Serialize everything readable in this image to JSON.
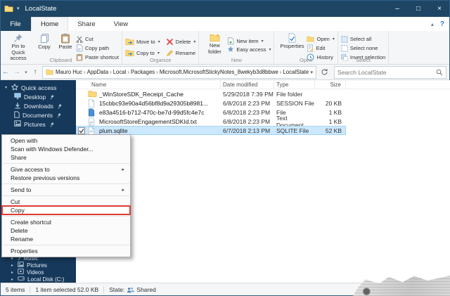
{
  "glyphs": {
    "min": "–",
    "max": "□",
    "close": "×",
    "dropdown": "▾",
    "submenu": "▸",
    "collapse": "▾",
    "expand": "▸",
    "crumb_sep": "›",
    "back": "←",
    "forward": "→",
    "up": "↑",
    "ribbon_toggle": "▴",
    "help": "?"
  },
  "window": {
    "title": "LocalState"
  },
  "ribbon": {
    "file_tab": "File",
    "tabs": [
      "Home",
      "Share",
      "View"
    ],
    "clipboard": {
      "pin": "Pin to Quick access",
      "copy": "Copy",
      "paste": "Paste",
      "cut": "Cut",
      "copy_path": "Copy path",
      "paste_shortcut": "Paste shortcut",
      "label": "Clipboard"
    },
    "organize": {
      "move_to": "Move to",
      "copy_to": "Copy to",
      "delete": "Delete",
      "rename": "Rename",
      "label": "Organize"
    },
    "new": {
      "new_folder": "New folder",
      "new_item": "New item",
      "easy_access": "Easy access",
      "label": "New"
    },
    "open": {
      "properties": "Properties",
      "open": "Open",
      "edit": "Edit",
      "history": "History",
      "label": "Open"
    },
    "select": {
      "select_all": "Select all",
      "select_none": "Select none",
      "invert": "Invert selection",
      "label": "Select"
    }
  },
  "addressbar": {
    "crumbs": [
      "Mauro Huc",
      "AppData",
      "Local",
      "Packages",
      "Microsoft.MicrosoftStickyNotes_8wekyb3d8bbwe",
      "LocalState"
    ],
    "search_placeholder": "Search LocalState"
  },
  "sidebar": {
    "quick_access": "Quick access",
    "pinned": [
      "Desktop",
      "Downloads",
      "Documents",
      "Pictures"
    ],
    "lower": [
      "Music",
      "Pictures",
      "Videos",
      "Local Disk (C:)"
    ]
  },
  "files": {
    "columns": [
      "Name",
      "Date modified",
      "Type",
      "Size"
    ],
    "rows": [
      {
        "name": "_WinStoreSDK_Receipt_Cache",
        "modified": "5/29/2018 7:39 PM",
        "type": "File folder",
        "size": ""
      },
      {
        "name": "15cbbc93e90a4d56bf8d9a29305b8981...",
        "modified": "6/8/2018 2:23 PM",
        "type": "SESSION File",
        "size": "20 KB"
      },
      {
        "name": "e83a4516-b712-470c-be7d-99d5fc4e7c",
        "modified": "6/8/2018 2:23 PM",
        "type": "File",
        "size": "1 KB"
      },
      {
        "name": "MicrosoftStoreEngagementSDKId.txt",
        "modified": "6/8/2018 2:23 PM",
        "type": "Text Document",
        "size": "1 KB"
      },
      {
        "name": "plum.sqlite",
        "modified": "6/7/2018 2:13 PM",
        "type": "SQLITE File",
        "size": "52 KB"
      }
    ]
  },
  "context_menu": {
    "items": [
      "Open with",
      "Scan with Windows Defender...",
      "Share",
      "Give access to",
      "Restore previous versions",
      "Send to",
      "Cut",
      "Copy",
      "Create shortcut",
      "Delete",
      "Rename",
      "Properties"
    ]
  },
  "statusbar": {
    "items_count": "5 items",
    "selection": "1 item selected 52.0 KB",
    "state_label": "State:",
    "state_value": "Shared"
  }
}
